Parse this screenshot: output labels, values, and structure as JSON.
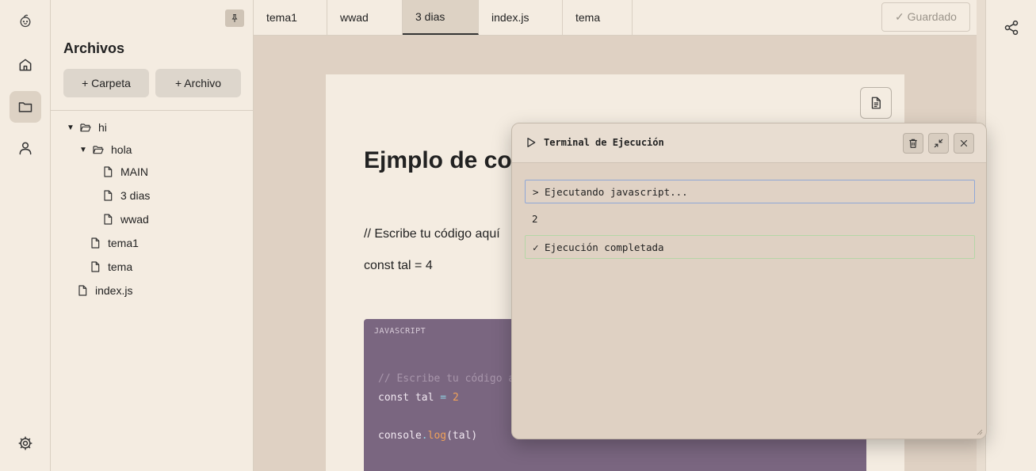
{
  "rail": {
    "items": [
      {
        "name": "mascot-logo-icon"
      },
      {
        "name": "home-icon"
      },
      {
        "name": "folder-icon"
      },
      {
        "name": "user-icon"
      },
      {
        "name": "settings-icon"
      }
    ]
  },
  "explorer": {
    "title": "Archivos",
    "new_folder_label": "+ Carpeta",
    "new_file_label": "+ Archivo",
    "tree": [
      {
        "label": "hi",
        "type": "folder",
        "expanded": true
      },
      {
        "label": "hola",
        "type": "folder",
        "expanded": true
      },
      {
        "label": "MAIN",
        "type": "file"
      },
      {
        "label": "3 dias",
        "type": "file"
      },
      {
        "label": "wwad",
        "type": "file"
      },
      {
        "label": "tema1",
        "type": "file"
      },
      {
        "label": "tema",
        "type": "file"
      },
      {
        "label": "index.js",
        "type": "file"
      }
    ]
  },
  "tabs": [
    {
      "label": "tema1",
      "active": false
    },
    {
      "label": "wwad",
      "active": false
    },
    {
      "label": "3 dias",
      "active": true
    },
    {
      "label": "index.js",
      "active": false
    },
    {
      "label": "tema",
      "active": false
    }
  ],
  "saved_label": "✓ Guardado",
  "document": {
    "heading": "Ejmplo de codigo",
    "lines": [
      "// Escribe tu código aquí",
      "const tal = 4"
    ],
    "code_language": "JAVASCRIPT",
    "code": {
      "comment": "// Escribe tu código aquí",
      "decl_keyword": "const",
      "decl_name": "tal",
      "decl_op": "=",
      "decl_value": "2",
      "call_obj": "console",
      "call_dot": ".",
      "call_fn": "log",
      "call_arg": "(tal)"
    }
  },
  "terminal": {
    "title": "Terminal de Ejecución",
    "lines": [
      {
        "text": "> Ejecutando javascript...",
        "kind": "info"
      },
      {
        "text": "2",
        "kind": "output"
      },
      {
        "text": "✓ Ejecución completada",
        "kind": "success"
      }
    ]
  },
  "colors": {
    "background": "#f4ece1",
    "editor_bg": "#dfd1c3",
    "code_bg": "#7a6680",
    "info_border": "#8fa7d6",
    "success_border": "#b5d6a7"
  }
}
